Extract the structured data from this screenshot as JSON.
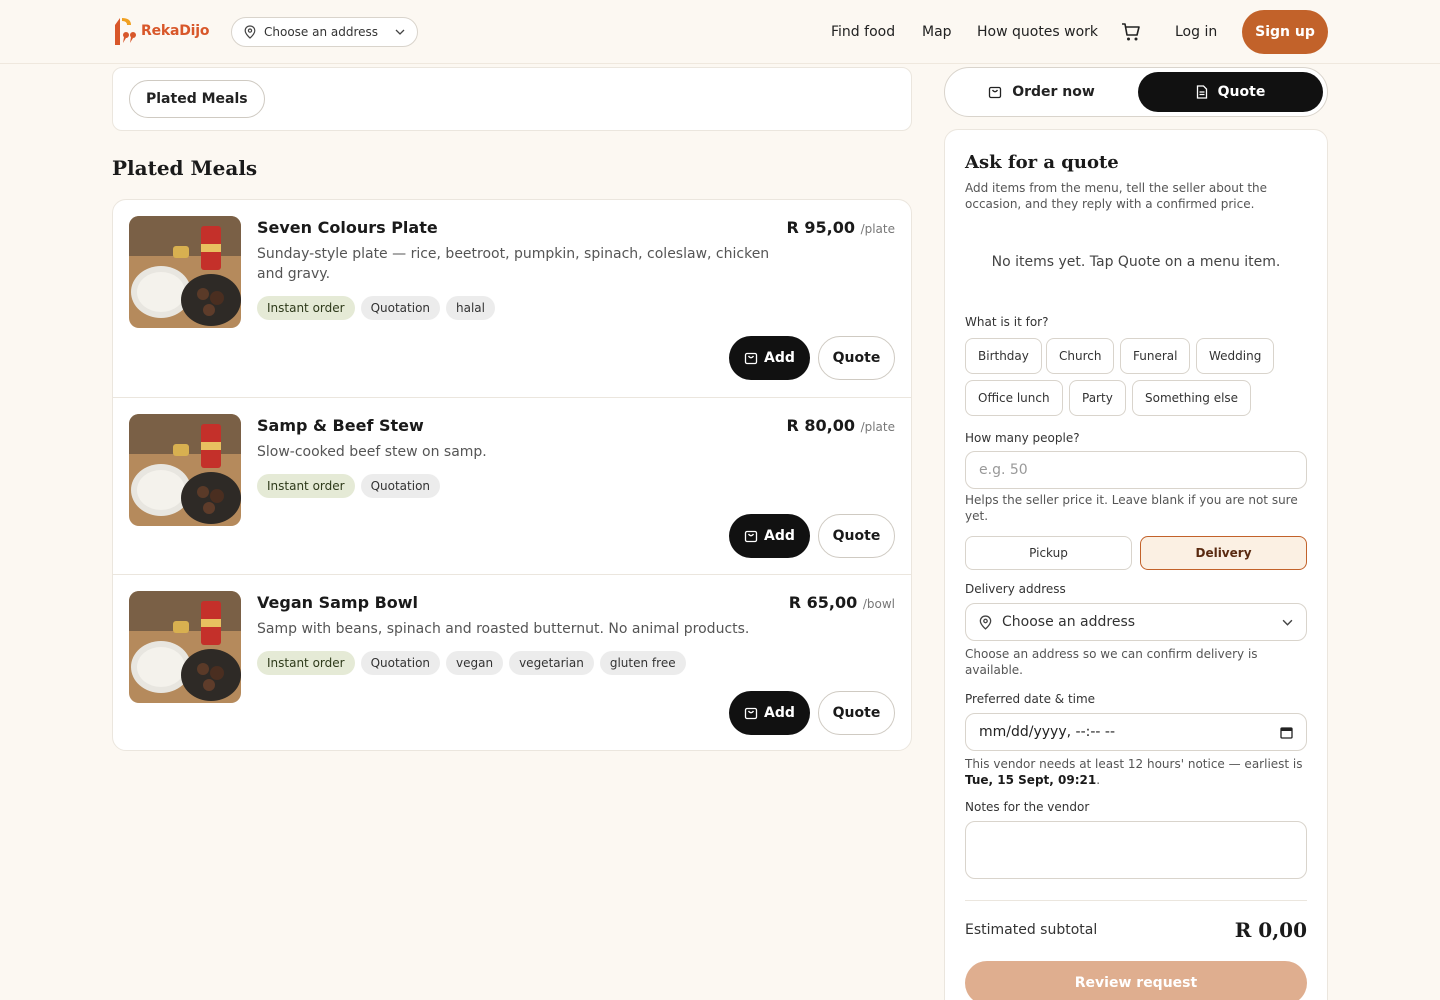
{
  "brand": {
    "name": "RekaDijo",
    "accent": "#c2622a",
    "logo_orange": "#d8572a"
  },
  "header": {
    "address_placeholder": "Choose an address",
    "nav": [
      "Find food",
      "Map",
      "How quotes work"
    ],
    "login": "Log in",
    "signup": "Sign up"
  },
  "categories": {
    "active": "Plated Meals"
  },
  "section": {
    "title": "Plated Meals"
  },
  "menu": [
    {
      "name": "Seven Colours Plate",
      "desc": "Sunday-style plate — rice, beetroot, pumpkin, spinach, coleslaw, chicken and gravy.",
      "price": "R 95,00",
      "unit": "/plate",
      "tags": [
        "Instant order",
        "Quotation",
        "halal"
      ]
    },
    {
      "name": "Samp & Beef Stew",
      "desc": "Slow-cooked beef stew on samp.",
      "price": "R 80,00",
      "unit": "/plate",
      "tags": [
        "Instant order",
        "Quotation"
      ]
    },
    {
      "name": "Vegan Samp Bowl",
      "desc": "Samp with beans, spinach and roasted butternut. No animal products.",
      "price": "R 65,00",
      "unit": "/bowl",
      "tags": [
        "Instant order",
        "Quotation",
        "vegan",
        "vegetarian",
        "gluten free"
      ]
    }
  ],
  "buttons": {
    "add": "Add",
    "quote": "Quote"
  },
  "toggle": {
    "order_now": "Order now",
    "quote": "Quote",
    "active": "quote"
  },
  "quote": {
    "title": "Ask for a quote",
    "subtitle": "Add items from the menu, tell the seller about the occasion, and they reply with a confirmed price.",
    "empty": "No items yet. Tap Quote on a menu item.",
    "occasion_label": "What is it for?",
    "occasions": [
      "Birthday",
      "Church",
      "Funeral",
      "Wedding",
      "Office lunch",
      "Party",
      "Something else"
    ],
    "people_label": "How many people?",
    "people_placeholder": "e.g. 50",
    "people_help": "Helps the seller price it. Leave blank if you are not sure yet.",
    "modes": [
      "Pickup",
      "Delivery"
    ],
    "mode_selected": "Delivery",
    "address_label": "Delivery address",
    "address_placeholder": "Choose an address",
    "address_help": "Choose an address so we can confirm delivery is available.",
    "date_label": "Preferred date & time",
    "date_value": "mm/dd/yyyy, --:-- --",
    "notice_text": "This vendor needs at least 12 hours' notice — earliest is",
    "notice_date": "Tue, 15 Sept, 09:21",
    "notes_label": "Notes for the vendor",
    "subtotal_label": "Estimated subtotal",
    "subtotal_value": "R 0,00",
    "review": "Review request"
  }
}
